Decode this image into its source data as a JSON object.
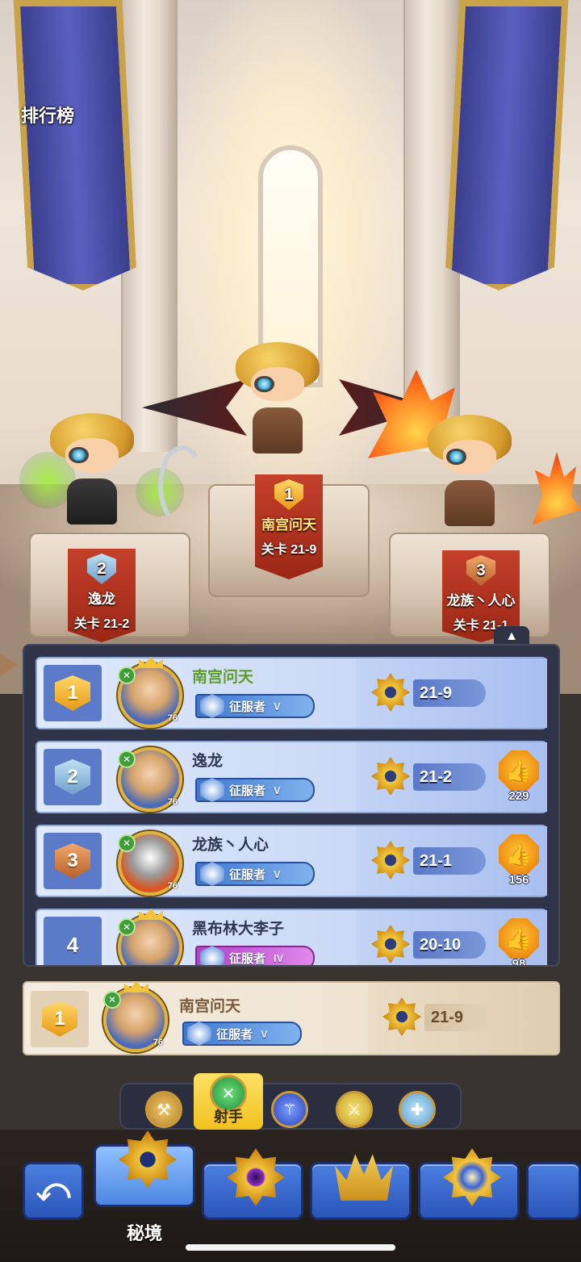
{
  "screen": {
    "title": "排行榜"
  },
  "podium": [
    {
      "rank": "2",
      "name": "逸龙",
      "stage": "关卡 21-2"
    },
    {
      "rank": "1",
      "name": "南宫问天",
      "stage": "关卡 21-9"
    },
    {
      "rank": "3",
      "name": "龙族丶人心",
      "stage": "关卡 21-1"
    }
  ],
  "collapse_button": {
    "icon": "triangle-up-icon",
    "glyph": "▲"
  },
  "ranking": [
    {
      "rank": "1",
      "name": "南宫问天",
      "level": "76",
      "title": "征服者",
      "title_tier": "V",
      "stage": "21-9",
      "likes": null
    },
    {
      "rank": "2",
      "name": "逸龙",
      "level": "76",
      "title": "征服者",
      "title_tier": "V",
      "stage": "21-2",
      "likes": "229"
    },
    {
      "rank": "3",
      "name": "龙族丶人心",
      "level": "76",
      "title": "征服者",
      "title_tier": "V",
      "stage": "21-1",
      "likes": "156"
    },
    {
      "rank": "4",
      "name": "黑布林大李子",
      "level": "76",
      "title": "征服者",
      "title_tier": "IV",
      "stage": "20-10",
      "likes": "98"
    }
  ],
  "self": {
    "rank": "1",
    "name": "南宫问天",
    "level": "76",
    "title": "征服者",
    "title_tier": "V",
    "stage": "21-9"
  },
  "class_filter": {
    "options": [
      "warrior-axe-icon",
      "archer-bow-icon",
      "mage-staff-icon",
      "assassin-blade-icon",
      "priest-cross-icon"
    ],
    "active_label": "射手"
  },
  "bottom_nav": {
    "back_glyph": "⤺",
    "active_label": "秘境"
  },
  "colors": {
    "panel_bg": "#2f3448",
    "row_bg": "#cad9f6",
    "self_row_bg": "#efe4d2",
    "gold": "#f2c43d",
    "accent_blue": "#4a7fe0",
    "name_green": "#5e9c2c"
  }
}
